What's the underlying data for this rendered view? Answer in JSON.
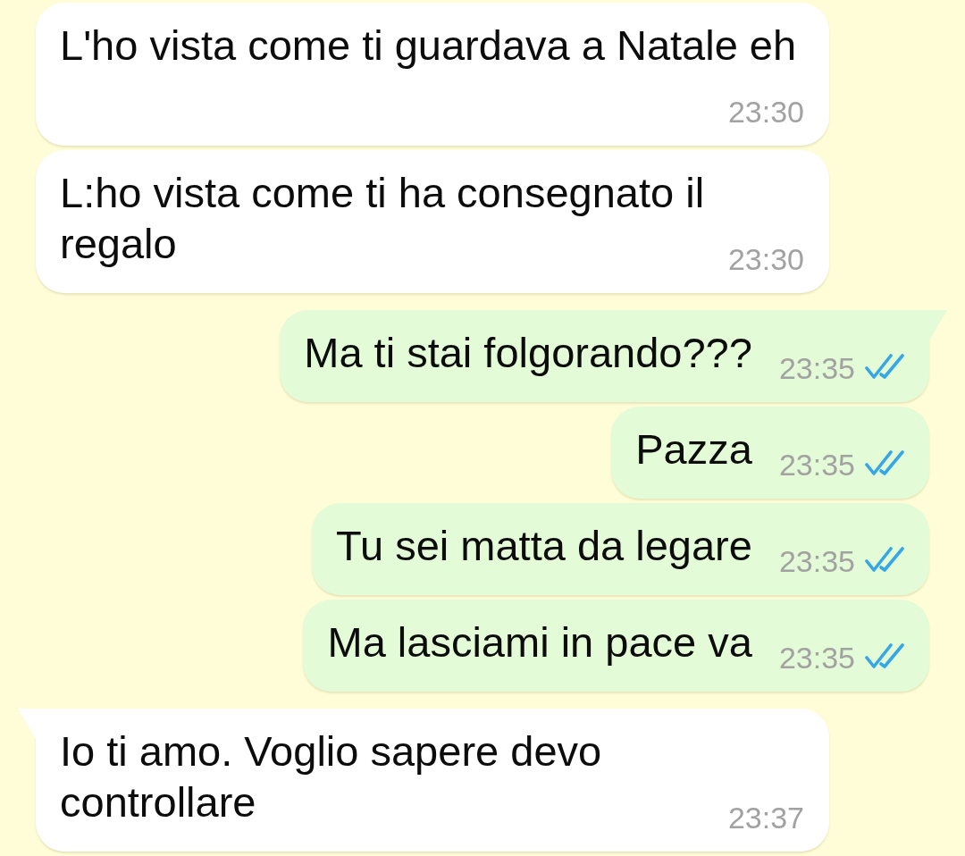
{
  "messages": [
    {
      "kind": "incoming",
      "text": "L'ho vista come ti guardava a Natale eh",
      "time": "23:30",
      "tail": false
    },
    {
      "kind": "incoming",
      "text": "L:ho vista come ti ha consegnato il regalo",
      "time": "23:30",
      "tail": false
    },
    {
      "kind": "outgoing",
      "text": "Ma ti stai folgorando???",
      "time": "23:35",
      "read": true,
      "tail": true
    },
    {
      "kind": "outgoing",
      "text": "Pazza",
      "time": "23:35",
      "read": true,
      "tail": false
    },
    {
      "kind": "outgoing",
      "text": "Tu sei matta da legare",
      "time": "23:35",
      "read": true,
      "tail": false
    },
    {
      "kind": "outgoing",
      "text": "Ma lasciami in pace va",
      "time": "23:35",
      "read": true,
      "tail": false
    },
    {
      "kind": "incoming",
      "text": "Io ti amo. Voglio sapere devo controllare",
      "time": "23:37",
      "tail": true
    }
  ]
}
